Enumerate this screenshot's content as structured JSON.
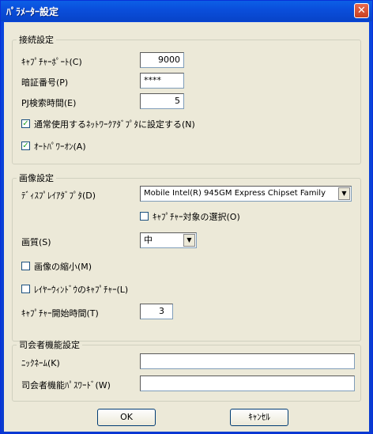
{
  "window": {
    "title": "ﾊﾟﾗﾒｰﾀｰ設定",
    "close_glyph": "✕"
  },
  "connection": {
    "legend": "接続設定",
    "capture_port_label": "ｷｬﾌﾟﾁｬｰﾎﾟｰﾄ(C)",
    "capture_port_value": "9000",
    "pin_label": "暗証番号(P)",
    "pin_value": "****",
    "pj_search_label": "PJ検索時間(E)",
    "pj_search_value": "5",
    "normal_adapter_label": "通常使用するﾈｯﾄﾜｰｸｱﾀﾞﾌﾟﾀに設定する(N)",
    "normal_adapter_checked": true,
    "auto_power_label": "ｵｰﾄﾊﾟﾜｰｵﾝ(A)",
    "auto_power_checked": true
  },
  "image": {
    "legend": "画像設定",
    "display_adapter_label": "ﾃﾞｨｽﾌﾟﾚｲｱﾀﾞﾌﾟﾀ(D)",
    "display_adapter_value": "Mobile Intel(R) 945GM Express Chipset Family",
    "capture_target_label": "ｷｬﾌﾟﾁｬｰ対象の選択(O)",
    "capture_target_checked": false,
    "quality_label": "画質(S)",
    "quality_value": "中",
    "shrink_label": "画像の縮小(M)",
    "shrink_checked": false,
    "layer_window_label": "ﾚｲﾔｰｳｨﾝﾄﾞｳのｷｬﾌﾟﾁｬｰ(L)",
    "layer_window_checked": false,
    "capture_start_label": "ｷｬﾌﾟﾁｬｰ開始時間(T)",
    "capture_start_value": "3"
  },
  "host": {
    "legend": "司会者機能設定",
    "nickname_label": "ﾆｯｸﾈｰﾑ(K)",
    "nickname_value": "",
    "password_label": "司会者機能ﾊﾟｽﾜｰﾄﾞ(W)",
    "password_value": ""
  },
  "buttons": {
    "ok": "OK",
    "cancel": "ｷｬﾝｾﾙ"
  }
}
